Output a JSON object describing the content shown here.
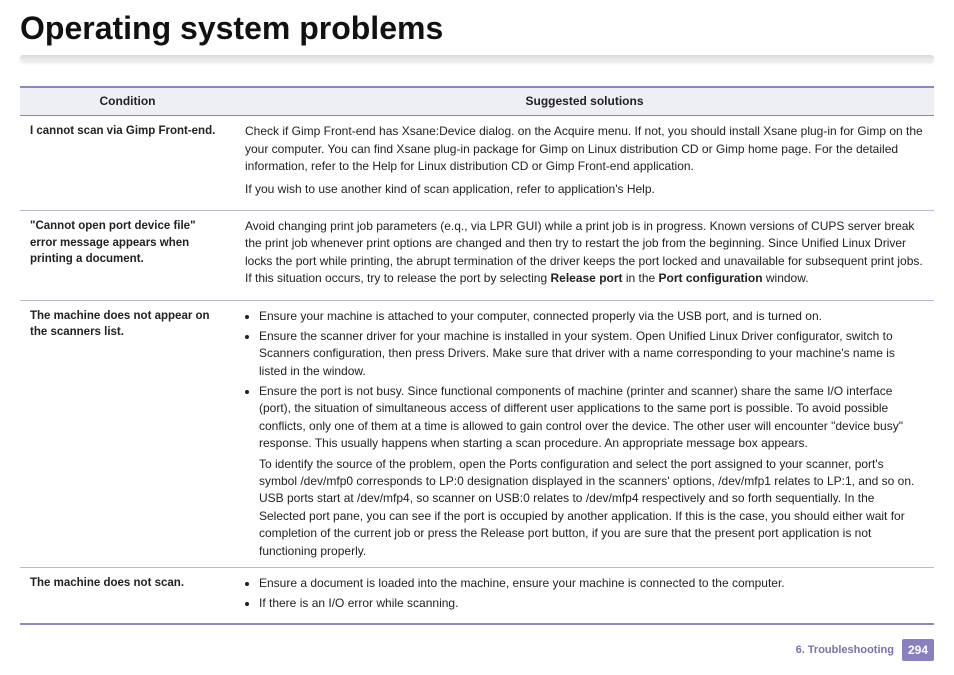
{
  "title": "Operating system problems",
  "headers": {
    "condition": "Condition",
    "solutions": "Suggested solutions"
  },
  "rows": [
    {
      "condition": "I cannot scan via Gimp Front-end.",
      "solution_paras": [
        "Check if Gimp Front-end has Xsane:Device dialog. on the Acquire menu. If not, you should install Xsane plug-in for Gimp on the your computer. You can find Xsane plug-in package for Gimp on Linux distribution CD or Gimp home page. For the detailed information, refer to the Help for Linux distribution CD or Gimp Front-end application.",
        "If you wish to use another kind of scan application, refer to application's Help."
      ]
    },
    {
      "condition": "\"Cannot open port device file\" error message appears when printing a document.",
      "solution_html": "Avoid changing print job parameters (e.q., via LPR GUI) while a print job is in progress. Known versions of CUPS server break the print job whenever print options are changed and then try to restart the job from the beginning. Since Unified Linux Driver locks the port while printing, the abrupt termination of the driver keeps the port locked and unavailable for subsequent print jobs. If this situation occurs, try to release the port by selecting <b>Release port</b> in the <b>Port configuration</b> window."
    },
    {
      "condition": "The machine does not appear on the scanners list.",
      "solution_bullets": [
        "Ensure your machine is attached to your computer, connected properly via the USB port, and is turned on.",
        "Ensure the scanner driver for your machine is installed in your system. Open Unified Linux Driver configurator, switch to Scanners configuration, then press Drivers. Make sure that driver with a name corresponding to your machine's name is listed in the window.",
        "Ensure the port is not busy. Since functional components of machine (printer and scanner) share the same I/O interface (port), the situation of simultaneous access of different user applications to the same port is possible. To avoid possible conflicts, only one of them at a time is allowed to gain control over the device. The other user will encounter \"device busy\" response. This usually happens when starting a scan procedure. An appropriate message box appears."
      ],
      "solution_extra": "To identify the source of the problem, open the Ports configuration and select the port assigned to your scanner, port's symbol /dev/mfp0 corresponds to LP:0 designation displayed in the scanners' options, /dev/mfp1 relates to LP:1, and so on. USB ports start at /dev/mfp4, so scanner on USB:0 relates to /dev/mfp4 respectively and so forth sequentially. In the Selected port pane, you can see if the port is occupied by another application. If this is the case, you should either wait for completion of the current job or press the Release port button, if you are sure that the present port application is not functioning properly."
    },
    {
      "condition": "The machine does not scan.",
      "solution_bullets": [
        "Ensure a document is loaded into the machine, ensure your machine is connected to the computer.",
        "If there is an I/O error while scanning."
      ]
    }
  ],
  "footer": {
    "chapter": "6.  Troubleshooting",
    "page": "294"
  }
}
